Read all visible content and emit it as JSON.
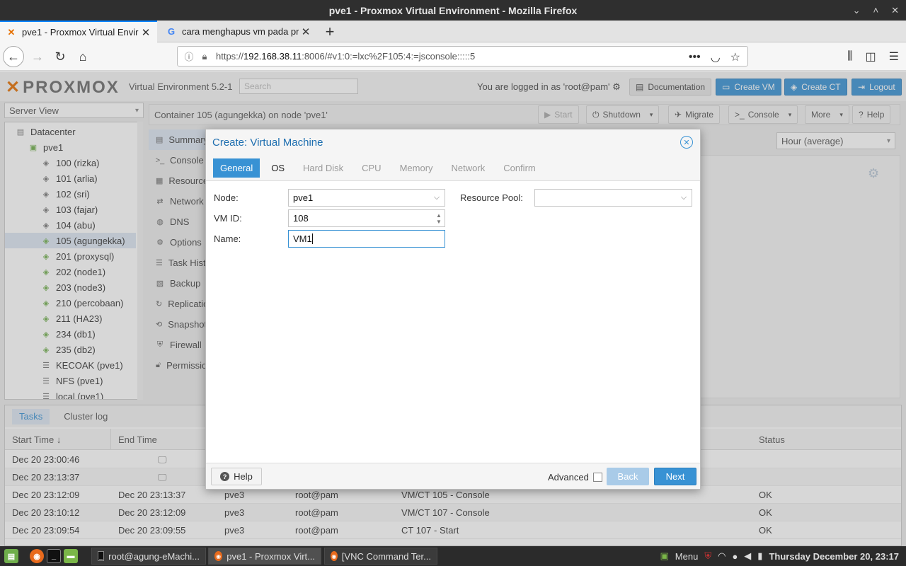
{
  "window": {
    "title": "pve1 - Proxmox Virtual Environment - Mozilla Firefox",
    "minimize": "⌄",
    "maximize": "˄",
    "close": "✕"
  },
  "browser": {
    "tabs": [
      {
        "label": "pve1 - Proxmox Virtual Enviro",
        "favicon": "proxmox-x-icon"
      },
      {
        "label": "cara menghapus vm pada pro",
        "favicon": "google-g-icon"
      }
    ],
    "url_prefix": "https://",
    "url_host": "192.168.38.11",
    "url_rest": ":8006/#v1:0:=lxc%2F105:4:=jsconsole:::::5"
  },
  "pve": {
    "logo": "PROXMOX",
    "version": "Virtual Environment 5.2-1",
    "search_placeholder": "Search",
    "logged_in": "You are logged in as 'root@pam'",
    "documentation": "Documentation",
    "create_vm": "Create VM",
    "create_ct": "Create CT",
    "logout": "Logout",
    "server_view": "Server View",
    "tree": [
      {
        "label": "Datacenter",
        "level": 0
      },
      {
        "label": "pve1",
        "level": 1
      },
      {
        "label": "100 (rizka)",
        "level": 2
      },
      {
        "label": "101 (arlia)",
        "level": 2
      },
      {
        "label": "102 (sri)",
        "level": 2
      },
      {
        "label": "103 (fajar)",
        "level": 2
      },
      {
        "label": "104 (abu)",
        "level": 2
      },
      {
        "label": "105 (agungekka)",
        "level": 2
      },
      {
        "label": "201 (proxysql)",
        "level": 2
      },
      {
        "label": "202 (node1)",
        "level": 2
      },
      {
        "label": "203 (node3)",
        "level": 2
      },
      {
        "label": "210 (percobaan)",
        "level": 2
      },
      {
        "label": "211 (HA23)",
        "level": 2
      },
      {
        "label": "234 (db1)",
        "level": 2
      },
      {
        "label": "235 (db2)",
        "level": 2
      },
      {
        "label": "KECOAK (pve1)",
        "level": 2
      },
      {
        "label": "NFS (pve1)",
        "level": 2
      },
      {
        "label": "local (pve1)",
        "level": 2
      }
    ],
    "breadcrumb": "Container 105 (agungekka) on node 'pve1'",
    "toolbar": {
      "start": "Start",
      "shutdown": "Shutdown",
      "migrate": "Migrate",
      "console": "Console",
      "more": "More",
      "help": "Help"
    },
    "subnav": [
      "Summary",
      "Console",
      "Resources",
      "Network",
      "DNS",
      "Options",
      "Task History",
      "Backup",
      "Replication",
      "Snapshots",
      "Firewall",
      "Permissions"
    ],
    "timeframe": "Hour (average)",
    "tasks": {
      "tabs": [
        "Tasks",
        "Cluster log"
      ],
      "columns": [
        "Start Time ↓",
        "End Time",
        "",
        "",
        "",
        "Status"
      ],
      "rows": [
        {
          "start": "Dec 20 23:00:46",
          "end": "",
          "node": "",
          "user": "",
          "desc": "",
          "status": ""
        },
        {
          "start": "Dec 20 23:13:37",
          "end": "",
          "node": "",
          "user": "",
          "desc": "",
          "status": ""
        },
        {
          "start": "Dec 20 23:12:09",
          "end": "Dec 20 23:13:37",
          "node": "pve3",
          "user": "root@pam",
          "desc": "VM/CT 105 - Console",
          "status": "OK"
        },
        {
          "start": "Dec 20 23:10:12",
          "end": "Dec 20 23:12:09",
          "node": "pve3",
          "user": "root@pam",
          "desc": "VM/CT 107 - Console",
          "status": "OK"
        },
        {
          "start": "Dec 20 23:09:54",
          "end": "Dec 20 23:09:55",
          "node": "pve3",
          "user": "root@pam",
          "desc": "CT 107 - Start",
          "status": "OK"
        }
      ]
    }
  },
  "dialog": {
    "title": "Create: Virtual Machine",
    "tabs": [
      "General",
      "OS",
      "Hard Disk",
      "CPU",
      "Memory",
      "Network",
      "Confirm"
    ],
    "node_label": "Node:",
    "node_value": "pve1",
    "vmid_label": "VM ID:",
    "vmid_value": "108",
    "name_label": "Name:",
    "name_value": "VM1",
    "pool_label": "Resource Pool:",
    "pool_value": "",
    "help": "Help",
    "advanced": "Advanced",
    "back": "Back",
    "next": "Next"
  },
  "taskbar": {
    "windows": [
      "root@agung-eMachi...",
      "pve1 - Proxmox Virt...",
      "[VNC Command Ter..."
    ],
    "menu": "Menu",
    "clock": "Thursday December 20, 23:17"
  },
  "colors": {
    "accent": "#3892d4",
    "proxmox_orange": "#e57000",
    "titlebar": "#2f2f2f"
  }
}
